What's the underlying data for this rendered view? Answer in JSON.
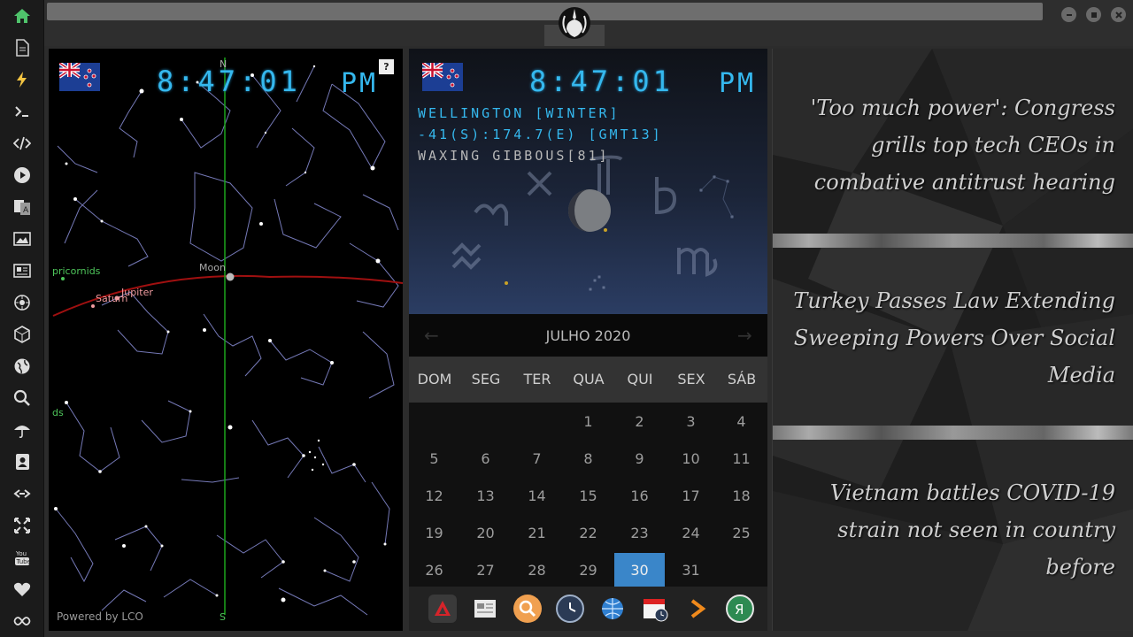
{
  "sidebar": {
    "items": [
      {
        "icon": "home-icon"
      },
      {
        "icon": "document-icon"
      },
      {
        "icon": "lightning-icon"
      },
      {
        "icon": "terminal-icon"
      },
      {
        "icon": "code-icon"
      },
      {
        "icon": "play-icon"
      },
      {
        "icon": "translate-icon"
      },
      {
        "icon": "image-icon"
      },
      {
        "icon": "news-icon"
      },
      {
        "icon": "settings-wheel-icon"
      },
      {
        "icon": "cube-icon"
      },
      {
        "icon": "globe-icon"
      },
      {
        "icon": "search-icon"
      },
      {
        "icon": "umbrella-icon"
      },
      {
        "icon": "contacts-icon"
      },
      {
        "icon": "link-icon"
      },
      {
        "icon": "fullscreen-icon"
      },
      {
        "icon": "youtube-icon"
      },
      {
        "icon": "heart-icon"
      },
      {
        "icon": "infinity-icon"
      }
    ]
  },
  "sky": {
    "time": "8:47:01",
    "ampm": "PM",
    "help_label": "?",
    "north": "N",
    "south": "S",
    "powered_by": "Powered by LCO",
    "labels": {
      "moon": "Moon",
      "saturn": "Saturn",
      "jupiter": "Jupiter",
      "meteor1": "pricornids",
      "meteor2": "ds"
    }
  },
  "astro": {
    "time": "8:47:01",
    "ampm": "PM",
    "city": "WELLINGTON [WINTER]",
    "coords": "-41(S):174.7(E) [GMT13]",
    "moon_phase": "WAXING GIBBOUS[81]"
  },
  "calendar": {
    "month": "JULHO 2020",
    "prev": "←",
    "next": "→",
    "weekdays": [
      "DOM",
      "SEG",
      "TER",
      "QUA",
      "QUI",
      "SEX",
      "SÁB"
    ],
    "weeks": [
      [
        "",
        "",
        "",
        "1",
        "2",
        "3",
        "4"
      ],
      [
        "5",
        "6",
        "7",
        "8",
        "9",
        "10",
        "11"
      ],
      [
        "12",
        "13",
        "14",
        "15",
        "16",
        "17",
        "18"
      ],
      [
        "19",
        "20",
        "21",
        "22",
        "23",
        "24",
        "25"
      ],
      [
        "26",
        "27",
        "28",
        "29",
        "30",
        "31",
        ""
      ]
    ],
    "today": "30"
  },
  "dock": {
    "icons": [
      "adobe-acrobat-icon",
      "newspaper-icon",
      "search-icon",
      "clock-icon",
      "globe-icon",
      "calendar-clock-icon",
      "forward-icon",
      "yandex-icon"
    ]
  },
  "news": {
    "headlines": [
      "'Too much power': Congress grills top tech CEOs in combative antitrust hearing",
      "Turkey Passes Law Extending Sweeping Powers Over Social Media",
      "Vietnam battles COVID-19 strain not seen in country before"
    ]
  },
  "colors": {
    "clock": "#35b8ee",
    "today_highlight": "#3a86c9",
    "home_icon": "#4fc36b"
  }
}
